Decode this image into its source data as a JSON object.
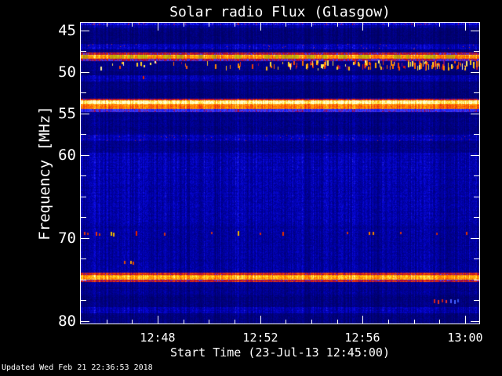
{
  "footer": {
    "updated_text": "Updated Wed Feb 21 22:36:53 2018"
  },
  "chart_data": {
    "type": "heatmap",
    "title": "Solar radio Flux (Glasgow)",
    "xlabel": "Start Time (23-Jul-13 12:45:00)",
    "ylabel": "Frequency [MHz]",
    "legend": "none",
    "grid": false,
    "x_axis": {
      "start_time": "12:45:00",
      "end_time": "13:00:33",
      "minutes_span": 15.55,
      "tick_labels": [
        "12:48",
        "12:52",
        "12:56",
        "13:00"
      ],
      "tick_minutes": [
        3,
        7,
        11,
        15
      ],
      "minor_tick_minutes": [
        1,
        2,
        4,
        5,
        6,
        8,
        9,
        10,
        12,
        13,
        14
      ]
    },
    "y_axis": {
      "min": 44.1,
      "max": 80.3,
      "unit": "MHz",
      "direction": "increasing-downward",
      "tick_labels": [
        "45",
        "50",
        "55",
        "60",
        "70",
        "80"
      ],
      "tick_values": [
        45,
        50,
        55,
        60,
        70,
        80
      ],
      "minor_tick_values": [
        47.5,
        52.5,
        57.5,
        62.5,
        65,
        67.5,
        72.5,
        75,
        77.5
      ]
    },
    "colors": {
      "frame": "#ffffff",
      "text": "#ffffff",
      "figure_bg": "#000000"
    },
    "palette_stops": [
      [
        0.0,
        "#00003c"
      ],
      [
        0.18,
        "#00006e"
      ],
      [
        0.3,
        "#0000aa"
      ],
      [
        0.42,
        "#0a0ae6"
      ],
      [
        0.52,
        "#4646ff"
      ],
      [
        0.56,
        "#8c005a"
      ],
      [
        0.62,
        "#d21914"
      ],
      [
        0.72,
        "#ff5a00"
      ],
      [
        0.82,
        "#ffa500"
      ],
      [
        0.9,
        "#ffe132"
      ],
      [
        1.0,
        "#ffffd7"
      ]
    ],
    "background_level": 0.22,
    "bands": [
      {
        "f1": 44.1,
        "f2": 44.4,
        "level": 0.4
      },
      {
        "f1": 44.4,
        "f2": 44.75,
        "level": 0.27
      },
      {
        "f1": 44.75,
        "f2": 46.6,
        "level": 0.2
      },
      {
        "f1": 46.6,
        "f2": 47.3,
        "level": 0.32,
        "speckle": "#b43c3c",
        "speckle_p": 0.01
      },
      {
        "f1": 47.3,
        "f2": 47.65,
        "level": 0.22
      },
      {
        "f1": 47.65,
        "f2": 47.95,
        "level": 0.58
      },
      {
        "f1": 47.95,
        "f2": 48.45,
        "level": 0.8,
        "green_tint": true
      },
      {
        "f1": 48.45,
        "f2": 48.7,
        "level": 0.56
      },
      {
        "f1": 48.7,
        "f2": 49.9,
        "level": 0.22
      },
      {
        "f1": 49.9,
        "f2": 50.4,
        "level": 0.19
      },
      {
        "f1": 50.4,
        "f2": 51.15,
        "level": 0.3
      },
      {
        "f1": 51.15,
        "f2": 53.2,
        "level": 0.21
      },
      {
        "f1": 53.2,
        "f2": 53.45,
        "level": 0.62
      },
      {
        "f1": 53.45,
        "f2": 53.95,
        "level": 0.93
      },
      {
        "f1": 53.95,
        "f2": 54.5,
        "level": 0.74
      },
      {
        "f1": 54.5,
        "f2": 54.85,
        "level": 0.5
      },
      {
        "f1": 54.85,
        "f2": 57.55,
        "level": 0.235
      },
      {
        "f1": 57.55,
        "f2": 58.35,
        "level": 0.31,
        "speckle": "#8c2850",
        "speckle_p": 0.012
      },
      {
        "f1": 58.35,
        "f2": 59.75,
        "level": 0.245
      },
      {
        "f1": 59.75,
        "f2": 62.0,
        "level": 0.31
      },
      {
        "f1": 62.0,
        "f2": 68.4,
        "level": 0.3
      },
      {
        "f1": 68.4,
        "f2": 69.9,
        "level": 0.27
      },
      {
        "f1": 69.9,
        "f2": 74.2,
        "level": 0.275
      },
      {
        "f1": 74.2,
        "f2": 74.5,
        "level": 0.62
      },
      {
        "f1": 74.5,
        "f2": 75.0,
        "level": 0.82
      },
      {
        "f1": 75.0,
        "f2": 75.3,
        "level": 0.6
      },
      {
        "f1": 75.3,
        "f2": 76.9,
        "level": 0.24
      },
      {
        "f1": 76.9,
        "f2": 78.3,
        "level": 0.21
      },
      {
        "f1": 78.3,
        "f2": 79.1,
        "level": 0.31
      },
      {
        "f1": 79.1,
        "f2": 80.3,
        "level": 0.21
      }
    ],
    "rfi_bursts": {
      "f_min": 48.6,
      "f_max": 49.85,
      "count": 170,
      "df_min": 0.25,
      "df_max": 0.8,
      "level_min": 0.55,
      "level_max": 0.97,
      "right_bias": 0.55
    },
    "events": [
      {
        "t": 0.15,
        "f": 69.25,
        "df": 0.4,
        "color": "#e03010"
      },
      {
        "t": 0.28,
        "f": 69.4,
        "df": 0.3,
        "color": "#c02810"
      },
      {
        "t": 0.6,
        "f": 69.25,
        "df": 0.45,
        "color": "#e03010"
      },
      {
        "t": 0.72,
        "f": 69.45,
        "df": 0.3,
        "color": "#d04000"
      },
      {
        "t": 1.18,
        "f": 69.3,
        "df": 0.5,
        "color": "#f0c000"
      },
      {
        "t": 1.3,
        "f": 69.35,
        "df": 0.45,
        "color": "#f0b000"
      },
      {
        "t": 2.18,
        "f": 69.15,
        "df": 0.6,
        "color": "#e02000"
      },
      {
        "t": 2.45,
        "f": 50.55,
        "df": 0.4,
        "color": "#e02800"
      },
      {
        "t": 3.28,
        "f": 69.35,
        "df": 0.35,
        "color": "#d03010"
      },
      {
        "t": 5.1,
        "f": 69.25,
        "df": 0.3,
        "color": "#c03020"
      },
      {
        "t": 6.15,
        "f": 69.2,
        "df": 0.55,
        "color": "#f0b000"
      },
      {
        "t": 7.0,
        "f": 69.35,
        "df": 0.3,
        "color": "#d02810"
      },
      {
        "t": 7.9,
        "f": 69.3,
        "df": 0.45,
        "color": "#e83000"
      },
      {
        "t": 10.4,
        "f": 69.25,
        "df": 0.3,
        "color": "#c83010"
      },
      {
        "t": 11.25,
        "f": 69.25,
        "df": 0.4,
        "color": "#f07000"
      },
      {
        "t": 11.42,
        "f": 69.3,
        "df": 0.4,
        "color": "#f08000"
      },
      {
        "t": 12.5,
        "f": 69.25,
        "df": 0.3,
        "color": "#d03010"
      },
      {
        "t": 13.9,
        "f": 69.35,
        "df": 0.3,
        "color": "#c02810"
      },
      {
        "t": 15.05,
        "f": 69.25,
        "df": 0.35,
        "color": "#d83000"
      },
      {
        "t": 1.72,
        "f": 72.8,
        "df": 0.35,
        "color": "#e05000"
      },
      {
        "t": 1.95,
        "f": 72.8,
        "df": 0.4,
        "color": "#f0a000"
      },
      {
        "t": 2.06,
        "f": 72.85,
        "df": 0.35,
        "color": "#e04000"
      },
      {
        "t": 13.8,
        "f": 77.4,
        "df": 0.5,
        "color": "#d02020"
      },
      {
        "t": 13.95,
        "f": 77.45,
        "df": 0.45,
        "color": "#e03020"
      },
      {
        "t": 14.1,
        "f": 77.4,
        "df": 0.4,
        "color": "#c02020"
      },
      {
        "t": 14.26,
        "f": 77.5,
        "df": 0.4,
        "color": "#d83030"
      },
      {
        "t": 14.45,
        "f": 77.4,
        "df": 0.5,
        "color": "#4858ff"
      },
      {
        "t": 14.6,
        "f": 77.45,
        "df": 0.45,
        "color": "#4060ff"
      },
      {
        "t": 14.72,
        "f": 77.4,
        "df": 0.4,
        "color": "#3050f0"
      }
    ]
  }
}
